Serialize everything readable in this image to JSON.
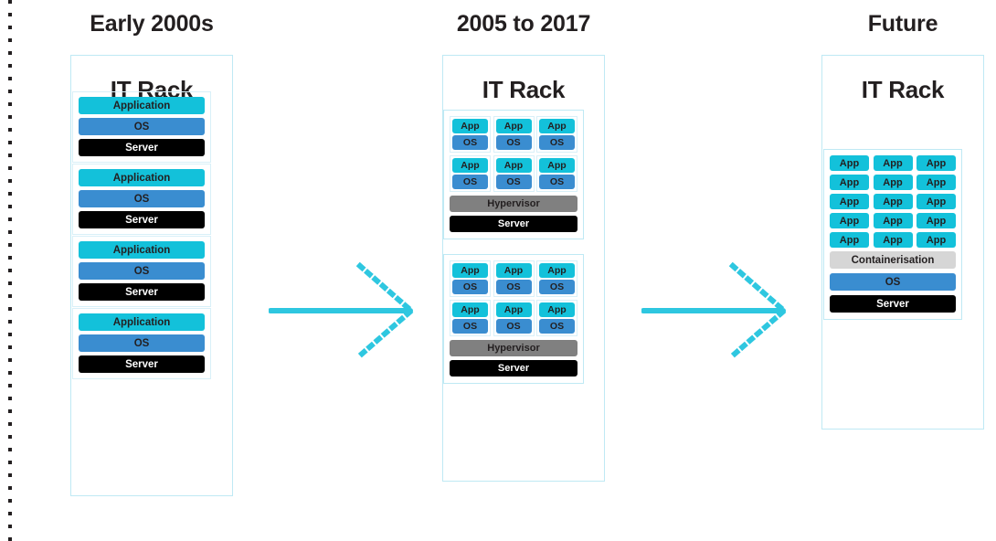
{
  "colors": {
    "app": "#13c1da",
    "os": "#3a8dd0",
    "server": "#000000",
    "hypervisor": "#808080",
    "containerisation": "#d6d6d6",
    "rack_border": "#bfe9f4",
    "arrow": "#2ec7e0",
    "text": "#231f20"
  },
  "decor": {
    "dotted_rule_name": "vertical-dotted-rule"
  },
  "columns": [
    {
      "id": "early",
      "title": "Early 2000s",
      "rack_label": "IT Rack",
      "groups": [
        {
          "bars": [
            {
              "label": "Application",
              "kind": "app"
            },
            {
              "label": "OS",
              "kind": "os"
            },
            {
              "label": "Server",
              "kind": "server"
            }
          ]
        },
        {
          "bars": [
            {
              "label": "Application",
              "kind": "app"
            },
            {
              "label": "OS",
              "kind": "os"
            },
            {
              "label": "Server",
              "kind": "server"
            }
          ]
        },
        {
          "bars": [
            {
              "label": "Application",
              "kind": "app"
            },
            {
              "label": "OS",
              "kind": "os"
            },
            {
              "label": "Server",
              "kind": "server"
            }
          ]
        },
        {
          "bars": [
            {
              "label": "Application",
              "kind": "app"
            },
            {
              "label": "OS",
              "kind": "os"
            },
            {
              "label": "Server",
              "kind": "server"
            }
          ]
        }
      ]
    },
    {
      "id": "mid",
      "title": "2005 to 2017",
      "rack_label": "IT Rack",
      "hypervisor_groups": [
        {
          "vm_rows": [
            [
              {
                "app": "App",
                "os": "OS"
              },
              {
                "app": "App",
                "os": "OS"
              },
              {
                "app": "App",
                "os": "OS"
              }
            ],
            [
              {
                "app": "App",
                "os": "OS"
              },
              {
                "app": "App",
                "os": "OS"
              },
              {
                "app": "App",
                "os": "OS"
              }
            ]
          ],
          "hypervisor_label": "Hypervisor",
          "server_label": "Server"
        },
        {
          "vm_rows": [
            [
              {
                "app": "App",
                "os": "OS"
              },
              {
                "app": "App",
                "os": "OS"
              },
              {
                "app": "App",
                "os": "OS"
              }
            ],
            [
              {
                "app": "App",
                "os": "OS"
              },
              {
                "app": "App",
                "os": "OS"
              },
              {
                "app": "App",
                "os": "OS"
              }
            ]
          ],
          "hypervisor_label": "Hypervisor",
          "server_label": "Server"
        }
      ]
    },
    {
      "id": "future",
      "title": "Future",
      "rack_label": "IT Rack",
      "app_rows": [
        [
          "App",
          "App",
          "App"
        ],
        [
          "App",
          "App",
          "App"
        ],
        [
          "App",
          "App",
          "App"
        ],
        [
          "App",
          "App",
          "App"
        ],
        [
          "App",
          "App",
          "App"
        ]
      ],
      "containerisation_label": "Containerisation",
      "os_label": "OS",
      "server_label": "Server"
    }
  ],
  "arrows": [
    {
      "name": "arrow-early-to-mid"
    },
    {
      "name": "arrow-mid-to-future"
    }
  ]
}
